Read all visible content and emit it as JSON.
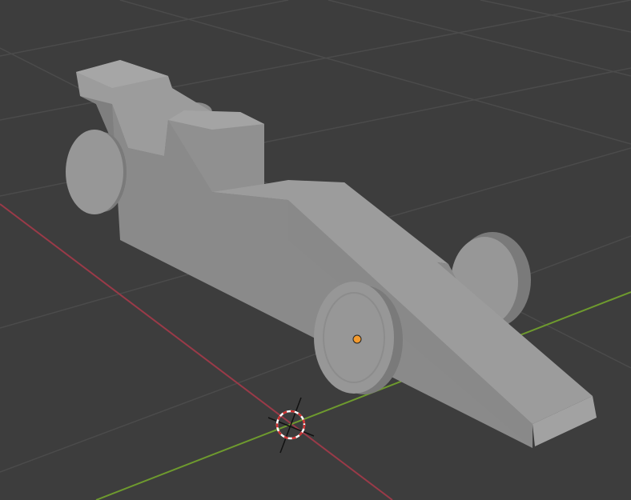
{
  "viewport": {
    "background": "#3d3d3d",
    "grid_color": "#4b4b4b",
    "x_axis_color": "#9a3a48",
    "y_axis_color": "#6e9a2e",
    "origin_color": "#f29a2e"
  },
  "model": {
    "body_top": "#9c9c9c",
    "body_side": "#8a8a8a",
    "body_dark": "#6f6f6f",
    "wheel_face": "#979797",
    "wheel_tire": "#7a7a7a"
  }
}
